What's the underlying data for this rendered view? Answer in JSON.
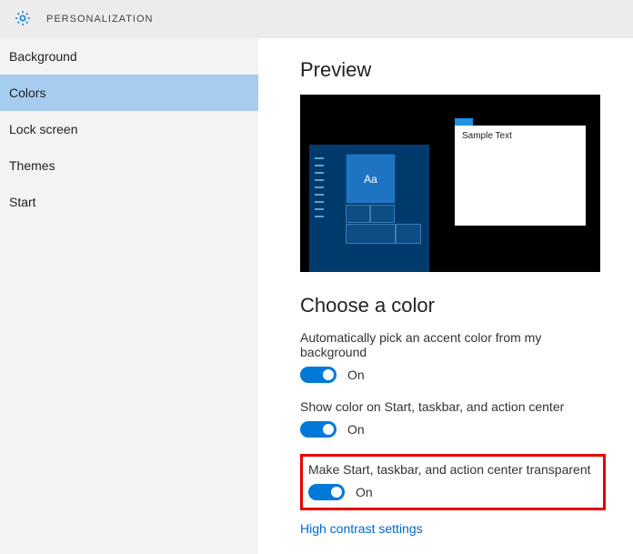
{
  "header": {
    "title": "PERSONALIZATION"
  },
  "sidebar": {
    "items": [
      {
        "label": "Background",
        "selected": false
      },
      {
        "label": "Colors",
        "selected": true
      },
      {
        "label": "Lock screen",
        "selected": false
      },
      {
        "label": "Themes",
        "selected": false
      },
      {
        "label": "Start",
        "selected": false
      }
    ]
  },
  "main": {
    "preview_heading": "Preview",
    "sample_text": "Sample Text",
    "tile_text": "Aa",
    "choose_heading": "Choose a color",
    "settings": [
      {
        "label": "Automatically pick an accent color from my background",
        "state": "On",
        "highlighted": false
      },
      {
        "label": "Show color on Start, taskbar, and action center",
        "state": "On",
        "highlighted": false
      },
      {
        "label": "Make Start, taskbar, and action center transparent",
        "state": "On",
        "highlighted": true
      }
    ],
    "link": "High contrast settings"
  }
}
